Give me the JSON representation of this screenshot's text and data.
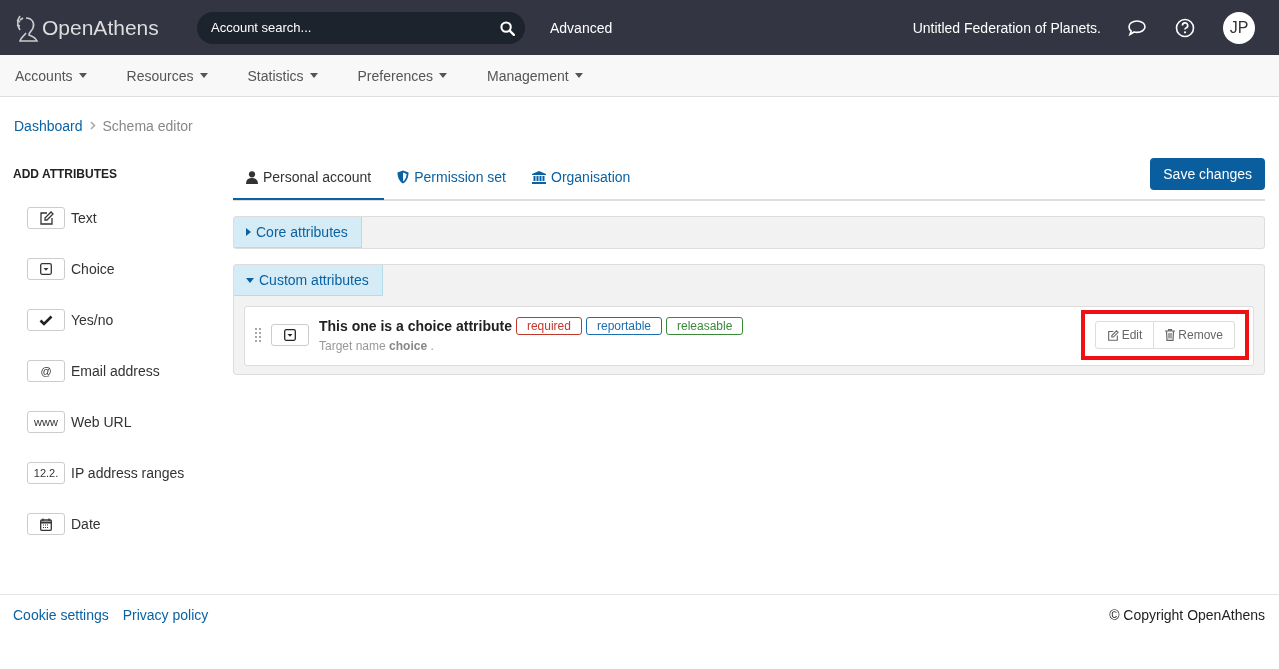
{
  "header": {
    "logo": "OpenAthens",
    "search": {
      "placeholder": "Account search..."
    },
    "advanced": "Advanced",
    "organisation": "Untitled Federation of Planets.",
    "avatar": "JP"
  },
  "nav": [
    {
      "label": "Accounts"
    },
    {
      "label": "Resources"
    },
    {
      "label": "Statistics"
    },
    {
      "label": "Preferences"
    },
    {
      "label": "Management"
    }
  ],
  "breadcrumb": {
    "link": "Dashboard",
    "current": "Schema editor"
  },
  "sidebar": {
    "title": "ADD ATTRIBUTES",
    "items": [
      {
        "kind": "text",
        "label": "Text"
      },
      {
        "kind": "choice",
        "label": "Choice"
      },
      {
        "kind": "yesno",
        "label": "Yes/no"
      },
      {
        "kind": "email",
        "icon_text": "@",
        "label": "Email address"
      },
      {
        "kind": "url",
        "icon_text": "www",
        "label": "Web URL"
      },
      {
        "kind": "ip",
        "icon_text": "12.2.",
        "label": "IP address ranges"
      },
      {
        "kind": "date",
        "label": "Date"
      }
    ]
  },
  "tabs": [
    {
      "kind": "person",
      "label": "Personal account",
      "selected": true
    },
    {
      "kind": "shield",
      "label": "Permission set",
      "selected": false
    },
    {
      "kind": "bank",
      "label": "Organisation",
      "selected": false
    }
  ],
  "save_button": "Save changes",
  "sections": [
    {
      "title": "Core attributes",
      "expanded": false
    },
    {
      "title": "Custom attributes",
      "expanded": true,
      "attributes": [
        {
          "kind": "choice",
          "name": "This one is a choice attribute",
          "tags": [
            {
              "label": "required",
              "color": "#c0392b"
            },
            {
              "label": "reportable",
              "color": "#1a6fb0"
            },
            {
              "label": "releasable",
              "color": "#3a8a3a"
            }
          ],
          "target_prefix": "Target name",
          "target": "choice",
          "target_suffix": ".",
          "edit": "Edit",
          "remove": "Remove",
          "highlighted": true
        }
      ]
    }
  ],
  "footer": {
    "links": [
      "Cookie settings",
      "Privacy policy"
    ],
    "copyright": "© Copyright OpenAthens"
  }
}
